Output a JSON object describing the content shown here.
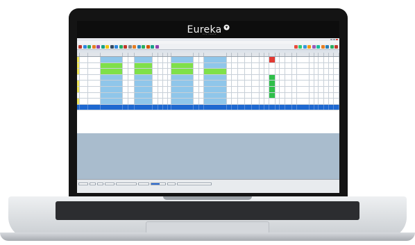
{
  "brand": {
    "name": "Eureka",
    "tagline": "SOFTWARE"
  },
  "colors": {
    "selected_row": "#1e68d0",
    "green": "#7fe04a",
    "blue": "#8fc6ea",
    "yellow": "#f2e85a",
    "red": "#e23a32",
    "status_green": "#2fbf4a"
  },
  "grid": {
    "columns": 34,
    "row_colors": [
      [
        "yellow",
        "white",
        "white",
        "blue",
        "white",
        "white",
        "blue",
        "white",
        "white",
        "white",
        "white",
        "blue",
        "white",
        "white",
        "blue",
        "white",
        "white",
        "white",
        "white",
        "white",
        "white",
        "white",
        "red",
        "white",
        "white",
        "white",
        "white",
        "white",
        "white",
        "white",
        "white",
        "white",
        "white",
        "white"
      ],
      [
        "yellow",
        "white",
        "white",
        "green",
        "white",
        "white",
        "green",
        "white",
        "white",
        "white",
        "white",
        "green",
        "white",
        "white",
        "blue",
        "white",
        "white",
        "white",
        "white",
        "white",
        "white",
        "white",
        "white",
        "white",
        "white",
        "white",
        "white",
        "white",
        "white",
        "white",
        "white",
        "white",
        "white",
        "white"
      ],
      [
        "yellow",
        "white",
        "white",
        "green",
        "white",
        "white",
        "green",
        "white",
        "white",
        "white",
        "white",
        "green",
        "white",
        "white",
        "green",
        "white",
        "white",
        "white",
        "white",
        "white",
        "white",
        "white",
        "white",
        "white",
        "white",
        "white",
        "white",
        "white",
        "white",
        "white",
        "white",
        "white",
        "white",
        "white"
      ],
      [
        "white",
        "white",
        "white",
        "blue",
        "white",
        "white",
        "blue",
        "white",
        "white",
        "white",
        "white",
        "blue",
        "white",
        "white",
        "blue",
        "white",
        "white",
        "white",
        "white",
        "white",
        "white",
        "white",
        "status_green",
        "white",
        "white",
        "white",
        "white",
        "white",
        "white",
        "white",
        "white",
        "white",
        "white",
        "white"
      ],
      [
        "yellow",
        "white",
        "white",
        "blue",
        "white",
        "white",
        "blue",
        "white",
        "white",
        "white",
        "white",
        "blue",
        "white",
        "white",
        "blue",
        "white",
        "white",
        "white",
        "white",
        "white",
        "white",
        "white",
        "status_green",
        "white",
        "white",
        "white",
        "white",
        "white",
        "white",
        "white",
        "white",
        "white",
        "white",
        "white"
      ],
      [
        "yellow",
        "white",
        "white",
        "blue",
        "white",
        "white",
        "blue",
        "white",
        "white",
        "white",
        "white",
        "blue",
        "white",
        "white",
        "blue",
        "white",
        "white",
        "white",
        "white",
        "white",
        "white",
        "white",
        "status_green",
        "white",
        "white",
        "white",
        "white",
        "white",
        "white",
        "white",
        "white",
        "white",
        "white",
        "white"
      ],
      [
        "white",
        "white",
        "white",
        "blue",
        "white",
        "white",
        "blue",
        "white",
        "white",
        "white",
        "white",
        "blue",
        "white",
        "white",
        "blue",
        "white",
        "white",
        "white",
        "white",
        "white",
        "white",
        "white",
        "status_green",
        "white",
        "white",
        "white",
        "white",
        "white",
        "white",
        "white",
        "white",
        "white",
        "white",
        "white"
      ],
      [
        "yellow",
        "white",
        "white",
        "blue",
        "white",
        "white",
        "blue",
        "white",
        "white",
        "white",
        "white",
        "blue",
        "white",
        "white",
        "blue",
        "white",
        "white",
        "white",
        "white",
        "white",
        "white",
        "white",
        "white",
        "white",
        "white",
        "white",
        "white",
        "white",
        "white",
        "white",
        "white",
        "white",
        "white",
        "white"
      ],
      [
        "white",
        "white",
        "white",
        "white",
        "white",
        "white",
        "white",
        "white",
        "white",
        "white",
        "white",
        "white",
        "white",
        "white",
        "white",
        "white",
        "white",
        "white",
        "white",
        "white",
        "white",
        "white",
        "white",
        "white",
        "white",
        "white",
        "white",
        "white",
        "white",
        "white",
        "white",
        "white",
        "white",
        "white"
      ]
    ],
    "selected_row_index": 8
  }
}
